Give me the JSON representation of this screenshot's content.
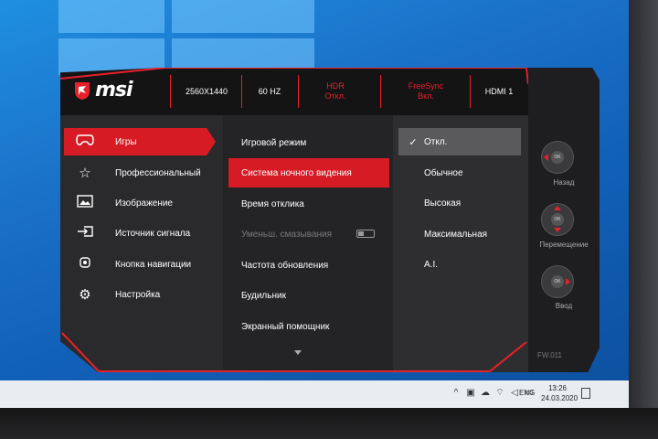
{
  "status_bar": {
    "resolution": "2560X1440",
    "refresh": "60 HZ",
    "hdr_label": "HDR",
    "hdr_value": "Откл.",
    "freesync_label": "FreeSync",
    "freesync_value": "Вкл.",
    "input": "HDMI 1"
  },
  "brand": {
    "logo_text": "msi"
  },
  "main_menu": [
    {
      "label": "Игры",
      "icon": "gamepad-icon",
      "active": true
    },
    {
      "label": "Профессиональный",
      "icon": "star-icon",
      "active": false
    },
    {
      "label": "Изображение",
      "icon": "image-icon",
      "active": false
    },
    {
      "label": "Источник сигнала",
      "icon": "input-source-icon",
      "active": false
    },
    {
      "label": "Кнопка навигации",
      "icon": "navigation-key-icon",
      "active": false
    },
    {
      "label": "Настройка",
      "icon": "gear-icon",
      "active": false
    }
  ],
  "submenu": [
    {
      "label": "Игровой режим",
      "state": "normal"
    },
    {
      "label": "Система ночного видения",
      "state": "active"
    },
    {
      "label": "Время отклика",
      "state": "normal"
    },
    {
      "label": "Уменьш. смазывания",
      "state": "disabled"
    },
    {
      "label": "Частота обновления",
      "state": "normal"
    },
    {
      "label": "Будильник",
      "state": "normal"
    },
    {
      "label": "Экранный помощник",
      "state": "normal"
    }
  ],
  "options": [
    {
      "label": "Откл.",
      "selected": true
    },
    {
      "label": "Обычное",
      "selected": false
    },
    {
      "label": "Высокая",
      "selected": false
    },
    {
      "label": "Максимальная",
      "selected": false
    },
    {
      "label": "A.I.",
      "selected": false
    }
  ],
  "nav_hints": {
    "back": "Назад",
    "move": "Перемещение",
    "enter": "Ввод",
    "ok_label": "OK"
  },
  "firmware": "FW.011",
  "taskbar": {
    "language": "ENG",
    "time": "13:26",
    "date": "24.03.2020"
  },
  "colors": {
    "accent": "#d61b24",
    "panel": "#2a2a2c",
    "desktop": "#1a6fc6"
  }
}
